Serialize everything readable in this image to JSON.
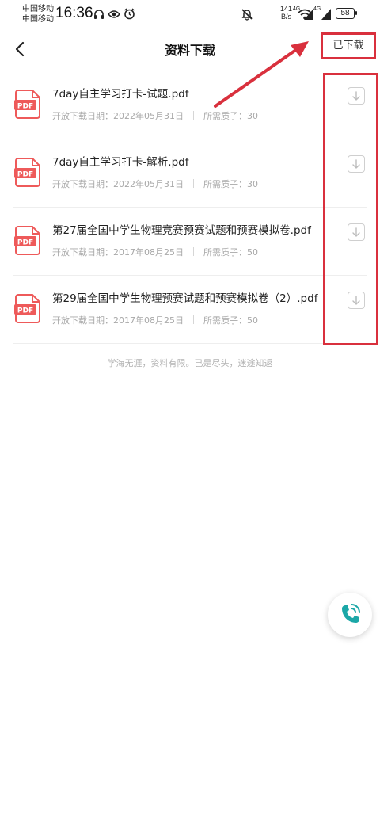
{
  "status_bar": {
    "carrier1": "中国移动",
    "carrier2": "中国移动",
    "time": "16:36",
    "net_speed_value": "141",
    "net_speed_unit": "B/s",
    "signal1_label": "4G",
    "signal2_label": "4G",
    "battery": "58"
  },
  "header": {
    "title": "资料下载",
    "downloaded_label": "已下载"
  },
  "files": [
    {
      "name": "7day自主学习打卡-试题.pdf",
      "date": "开放下载日期：2022年05月31日",
      "cost": "所需质子：30",
      "icon_text": "PDF"
    },
    {
      "name": "7day自主学习打卡-解析.pdf",
      "date": "开放下载日期：2022年05月31日",
      "cost": "所需质子：30",
      "icon_text": "PDF"
    },
    {
      "name": "第27届全国中学生物理竞赛预赛试题和预赛模拟卷.pdf",
      "date": "开放下载日期：2017年08月25日",
      "cost": "所需质子：50",
      "icon_text": "PDF"
    },
    {
      "name": "第29届全国中学生物理预赛试题和预赛模拟卷（2）.pdf",
      "date": "开放下载日期：2017年08月25日",
      "cost": "所需质子：50",
      "icon_text": "PDF"
    }
  ],
  "footer_note": "学海无涯，资料有限。已是尽头，迷途知返",
  "colors": {
    "accent_red": "#d9303d",
    "pdf_red": "#ee5a5a",
    "fab_teal": "#1ba7a7"
  }
}
